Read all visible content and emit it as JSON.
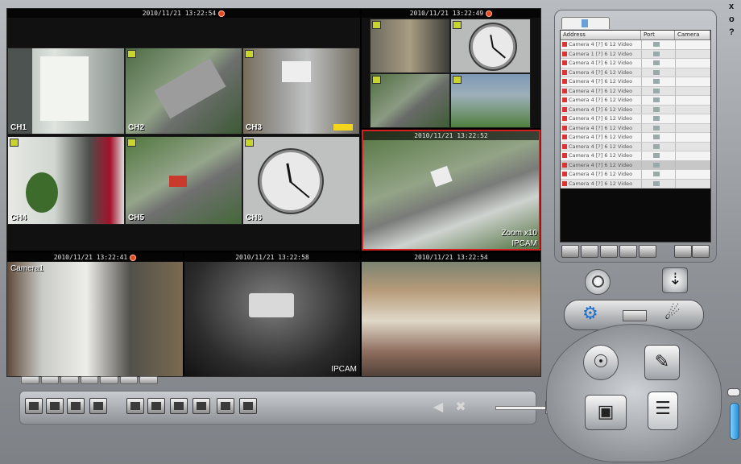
{
  "window": {
    "controls": [
      "x",
      "o",
      "?"
    ]
  },
  "panes": {
    "top_left": {
      "timestamp": "2010/11/21 13:22:54",
      "channels": [
        "CH1",
        "CH2",
        "CH3",
        "CH4",
        "CH5",
        "CH6"
      ]
    },
    "top_right": {
      "timestamp": "2010/11/21 13:22:49"
    },
    "selected": {
      "timestamp": "2010/11/21 13:22:52",
      "zoom_label": "Zoom x10",
      "camera_label": "IPCAM"
    },
    "bottom_left": {
      "timestamp": "2010/11/21 13:22:41",
      "camera_label": "Camera1"
    },
    "bottom_mid": {
      "timestamp": "2010/11/21 13:22:58",
      "camera_label": "IPCAM"
    },
    "bottom_right": {
      "timestamp": "2010/11/21 13:22:54"
    }
  },
  "device_list": {
    "columns": [
      "Address",
      "Port",
      "Camera"
    ],
    "rows": [
      "Camera 4 [?] 6 12 Video",
      "Camera 1 [?] 6 12 Video",
      "Camera 4 [?] 6 12 Video",
      "Camera 4 [?] 6 12 Video",
      "Camera 4 [?] 6 12 Video",
      "Camera 4 [?] 6 12 Video",
      "Camera 4 [?] 6 12 Video",
      "Camera 4 [?] 6 12 Video",
      "Camera 4 [?] 6 12 Video",
      "Camera 4 [?] 6 12 Video",
      "Camera 4 [?] 6 12 Video",
      "Camera 4 [?] 6 12 Video",
      "Camera 4 [?] 6 12 Video",
      "Camera 4 [?] 6 12 Video",
      "Camera 4 [?] 6 12 Video",
      "Camera 4 [?] 6 12 Video"
    ]
  },
  "colors": {
    "selection": "#d42020",
    "recording": "#e34a1f",
    "accent_blue": "#2a8fd6"
  },
  "icons": {
    "search": "magnifier-icon",
    "import": "import-icon",
    "settings": "gears-icon",
    "device": "device-icon",
    "network": "network-icon",
    "record": "film-reel-icon",
    "playback": "video-camera-icon",
    "snapshot": "camera-icon",
    "log": "document-icon"
  }
}
